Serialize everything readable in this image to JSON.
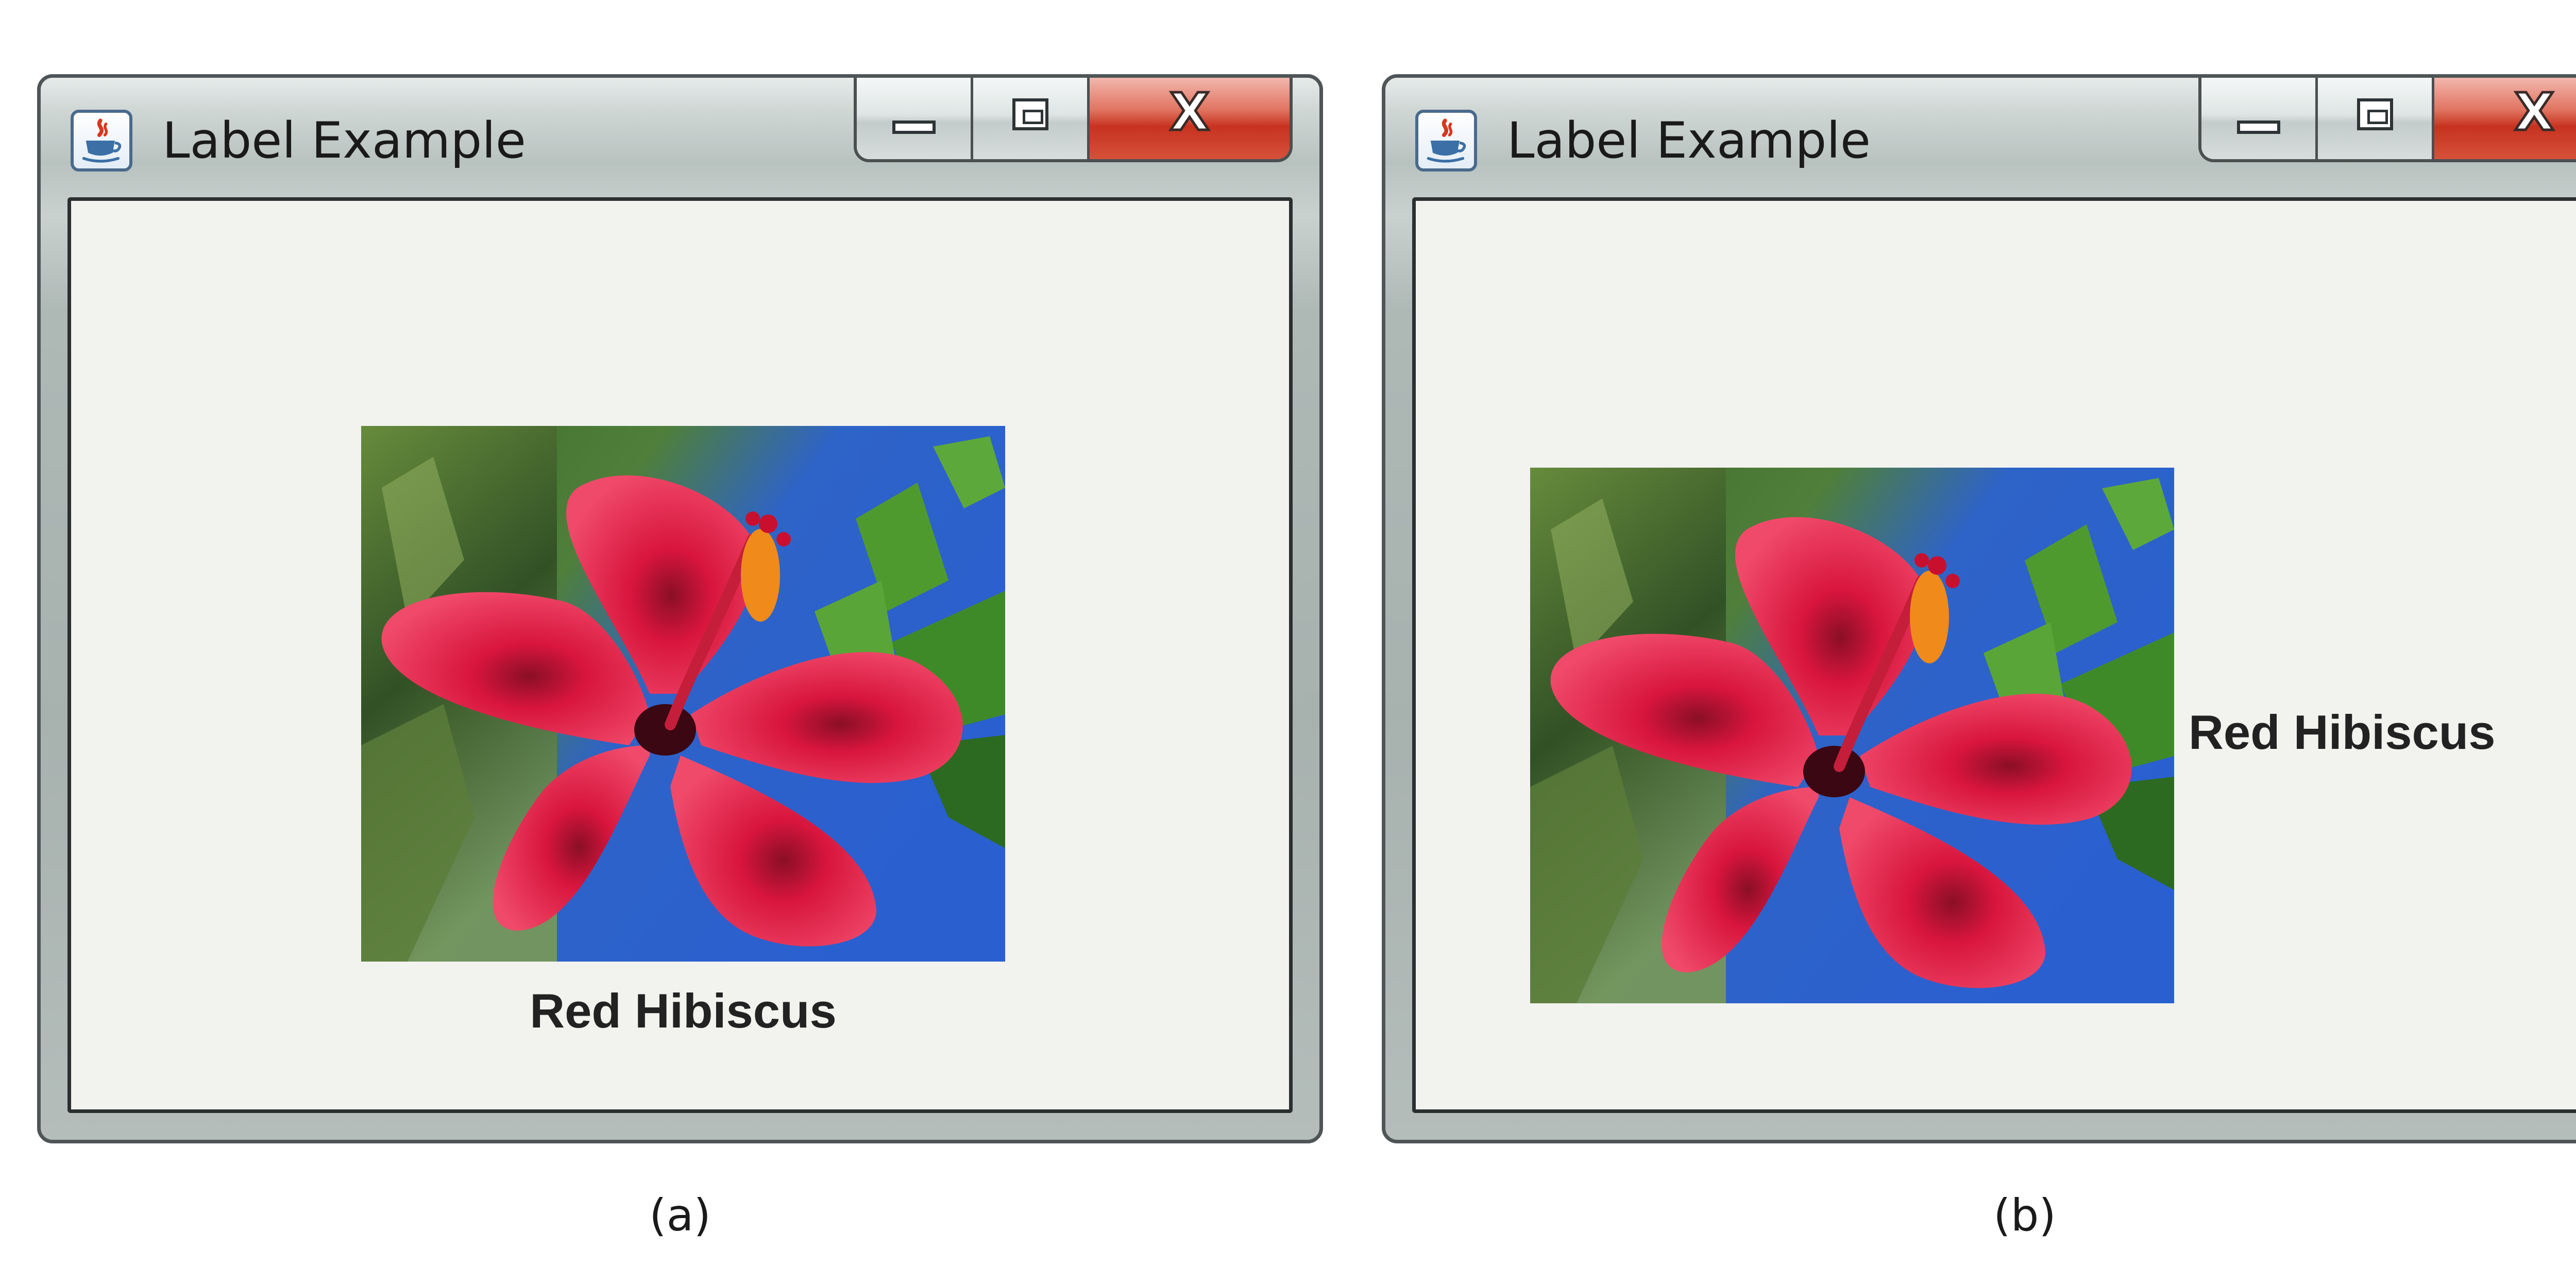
{
  "figures": [
    {
      "caption": "(a)",
      "window": {
        "title": "Label Example",
        "label": {
          "text": "Red Hibiscus",
          "icon": "red-hibiscus-photo",
          "text_position": "below-icon"
        },
        "caption_buttons": {
          "close_glyph": "X"
        }
      }
    },
    {
      "caption": "(b)",
      "window": {
        "title": "Label Example",
        "label": {
          "text": "Red Hibiscus",
          "icon": "red-hibiscus-photo",
          "text_position": "right-of-icon"
        },
        "caption_buttons": {
          "close_glyph": "X"
        }
      }
    }
  ],
  "colors": {
    "client_background": "#f2f2ef",
    "title_bar": "#c9d1cf",
    "close_button": "#c7321f",
    "flower": "#e0203f",
    "sky": "#2f6fd6",
    "foliage": "#3f7a2c"
  }
}
